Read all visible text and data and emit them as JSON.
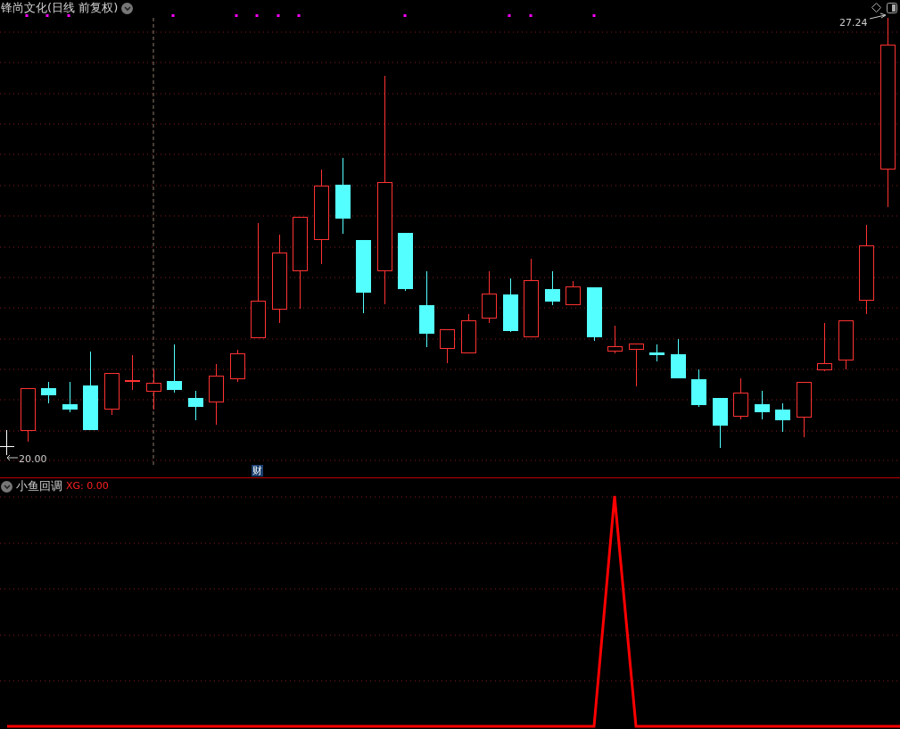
{
  "price_panel": {
    "title": "锋尚文化(日线 前复权)",
    "high_label": "27.24",
    "low_label": "20.00",
    "event_marker": "财"
  },
  "indicator_panel": {
    "name": "小鱼回调",
    "reading": "XG: 0.00"
  }
}
